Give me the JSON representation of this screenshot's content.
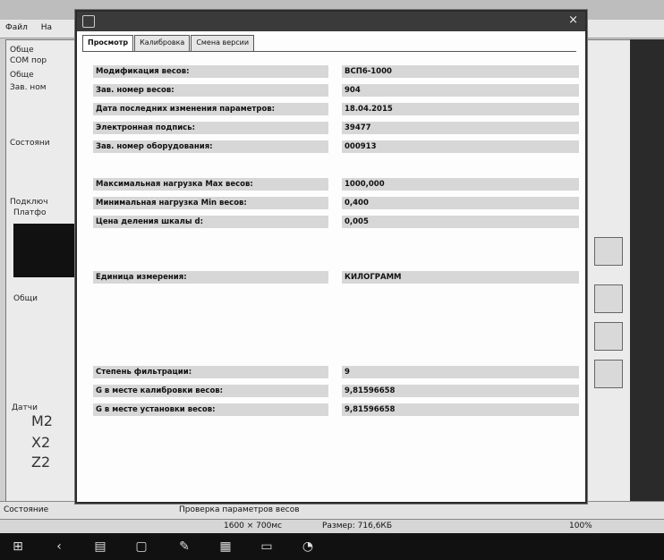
{
  "background": {
    "menu": [
      "Файл",
      "На"
    ],
    "left_labels": [
      "Обще",
      "COM пор",
      "Обще",
      "Зав. ном",
      "Состояни",
      "Подключ",
      "Платфо",
      "Общи",
      "Датчи"
    ],
    "sensors": [
      "M2",
      "X2",
      "Z2"
    ],
    "status_text": "Состояние",
    "status_center": "Проверка параметров весов"
  },
  "zoom_bar": {
    "resolution": "1600 × 700мс",
    "size": "Размер: 716,6КБ",
    "zoom": "100%"
  },
  "dialog": {
    "tabs": [
      "Просмотр",
      "Калибровка",
      "Смена версии"
    ],
    "active_tab": 0,
    "fields": [
      {
        "label": "Модификация весов:",
        "value": "ВСП6-1000"
      },
      {
        "label": "Зав. номер весов:",
        "value": "904"
      },
      {
        "label": "Дата последних изменения параметров:",
        "value": "18.04.2015"
      },
      {
        "label": "Электронная подпись:",
        "value": "39477"
      },
      {
        "label": "Зав. номер оборудования:",
        "value": "000913"
      },
      {
        "label": "Максимальная нагрузка Max весов:",
        "value": "1000,000"
      },
      {
        "label": "Минимальная нагрузка Min весов:",
        "value": "0,400"
      },
      {
        "label": "Цена деления шкалы d:",
        "value": "0,005"
      },
      {
        "label": "Единица измерения:",
        "value": "КИЛОГРАММ"
      },
      {
        "label": "Степень фильтрации:",
        "value": "9"
      },
      {
        "label": "G в месте калибровки весов:",
        "value": "9,81596658"
      },
      {
        "label": "G в месте установки весов:",
        "value": "9,81596658"
      }
    ]
  },
  "colors": {
    "field_bg": "#d7d7d7",
    "dialog_title": "#3a3a3a",
    "taskbar": "#111111"
  }
}
